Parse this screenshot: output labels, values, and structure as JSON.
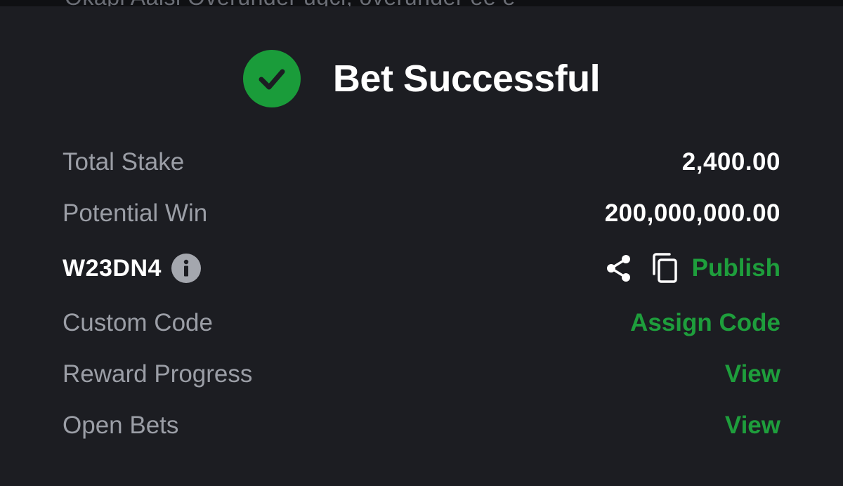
{
  "top_strip": {
    "text": "Okapi Aalsi Overunder ugci, overunder ee e"
  },
  "header": {
    "title": "Bet Successful",
    "icon": "check-circle-icon",
    "icon_color": "#1a9c3a"
  },
  "rows": {
    "total_stake": {
      "label": "Total Stake",
      "value": "2,400.00"
    },
    "potential_win": {
      "label": "Potential Win",
      "value": "200,000,000.00"
    },
    "booking": {
      "code": "W23DN4",
      "info_icon": "info-icon",
      "share_icon": "share-icon",
      "copy_icon": "copy-icon",
      "publish_label": "Publish"
    },
    "custom_code": {
      "label": "Custom Code",
      "action": "Assign Code"
    },
    "reward_progress": {
      "label": "Reward Progress",
      "action": "View"
    },
    "open_bets": {
      "label": "Open Bets",
      "action": "View"
    }
  },
  "colors": {
    "background": "#1c1d22",
    "accent_green": "#1e9e3c",
    "label_gray": "#9b9ea6",
    "text_white": "#ffffff"
  }
}
